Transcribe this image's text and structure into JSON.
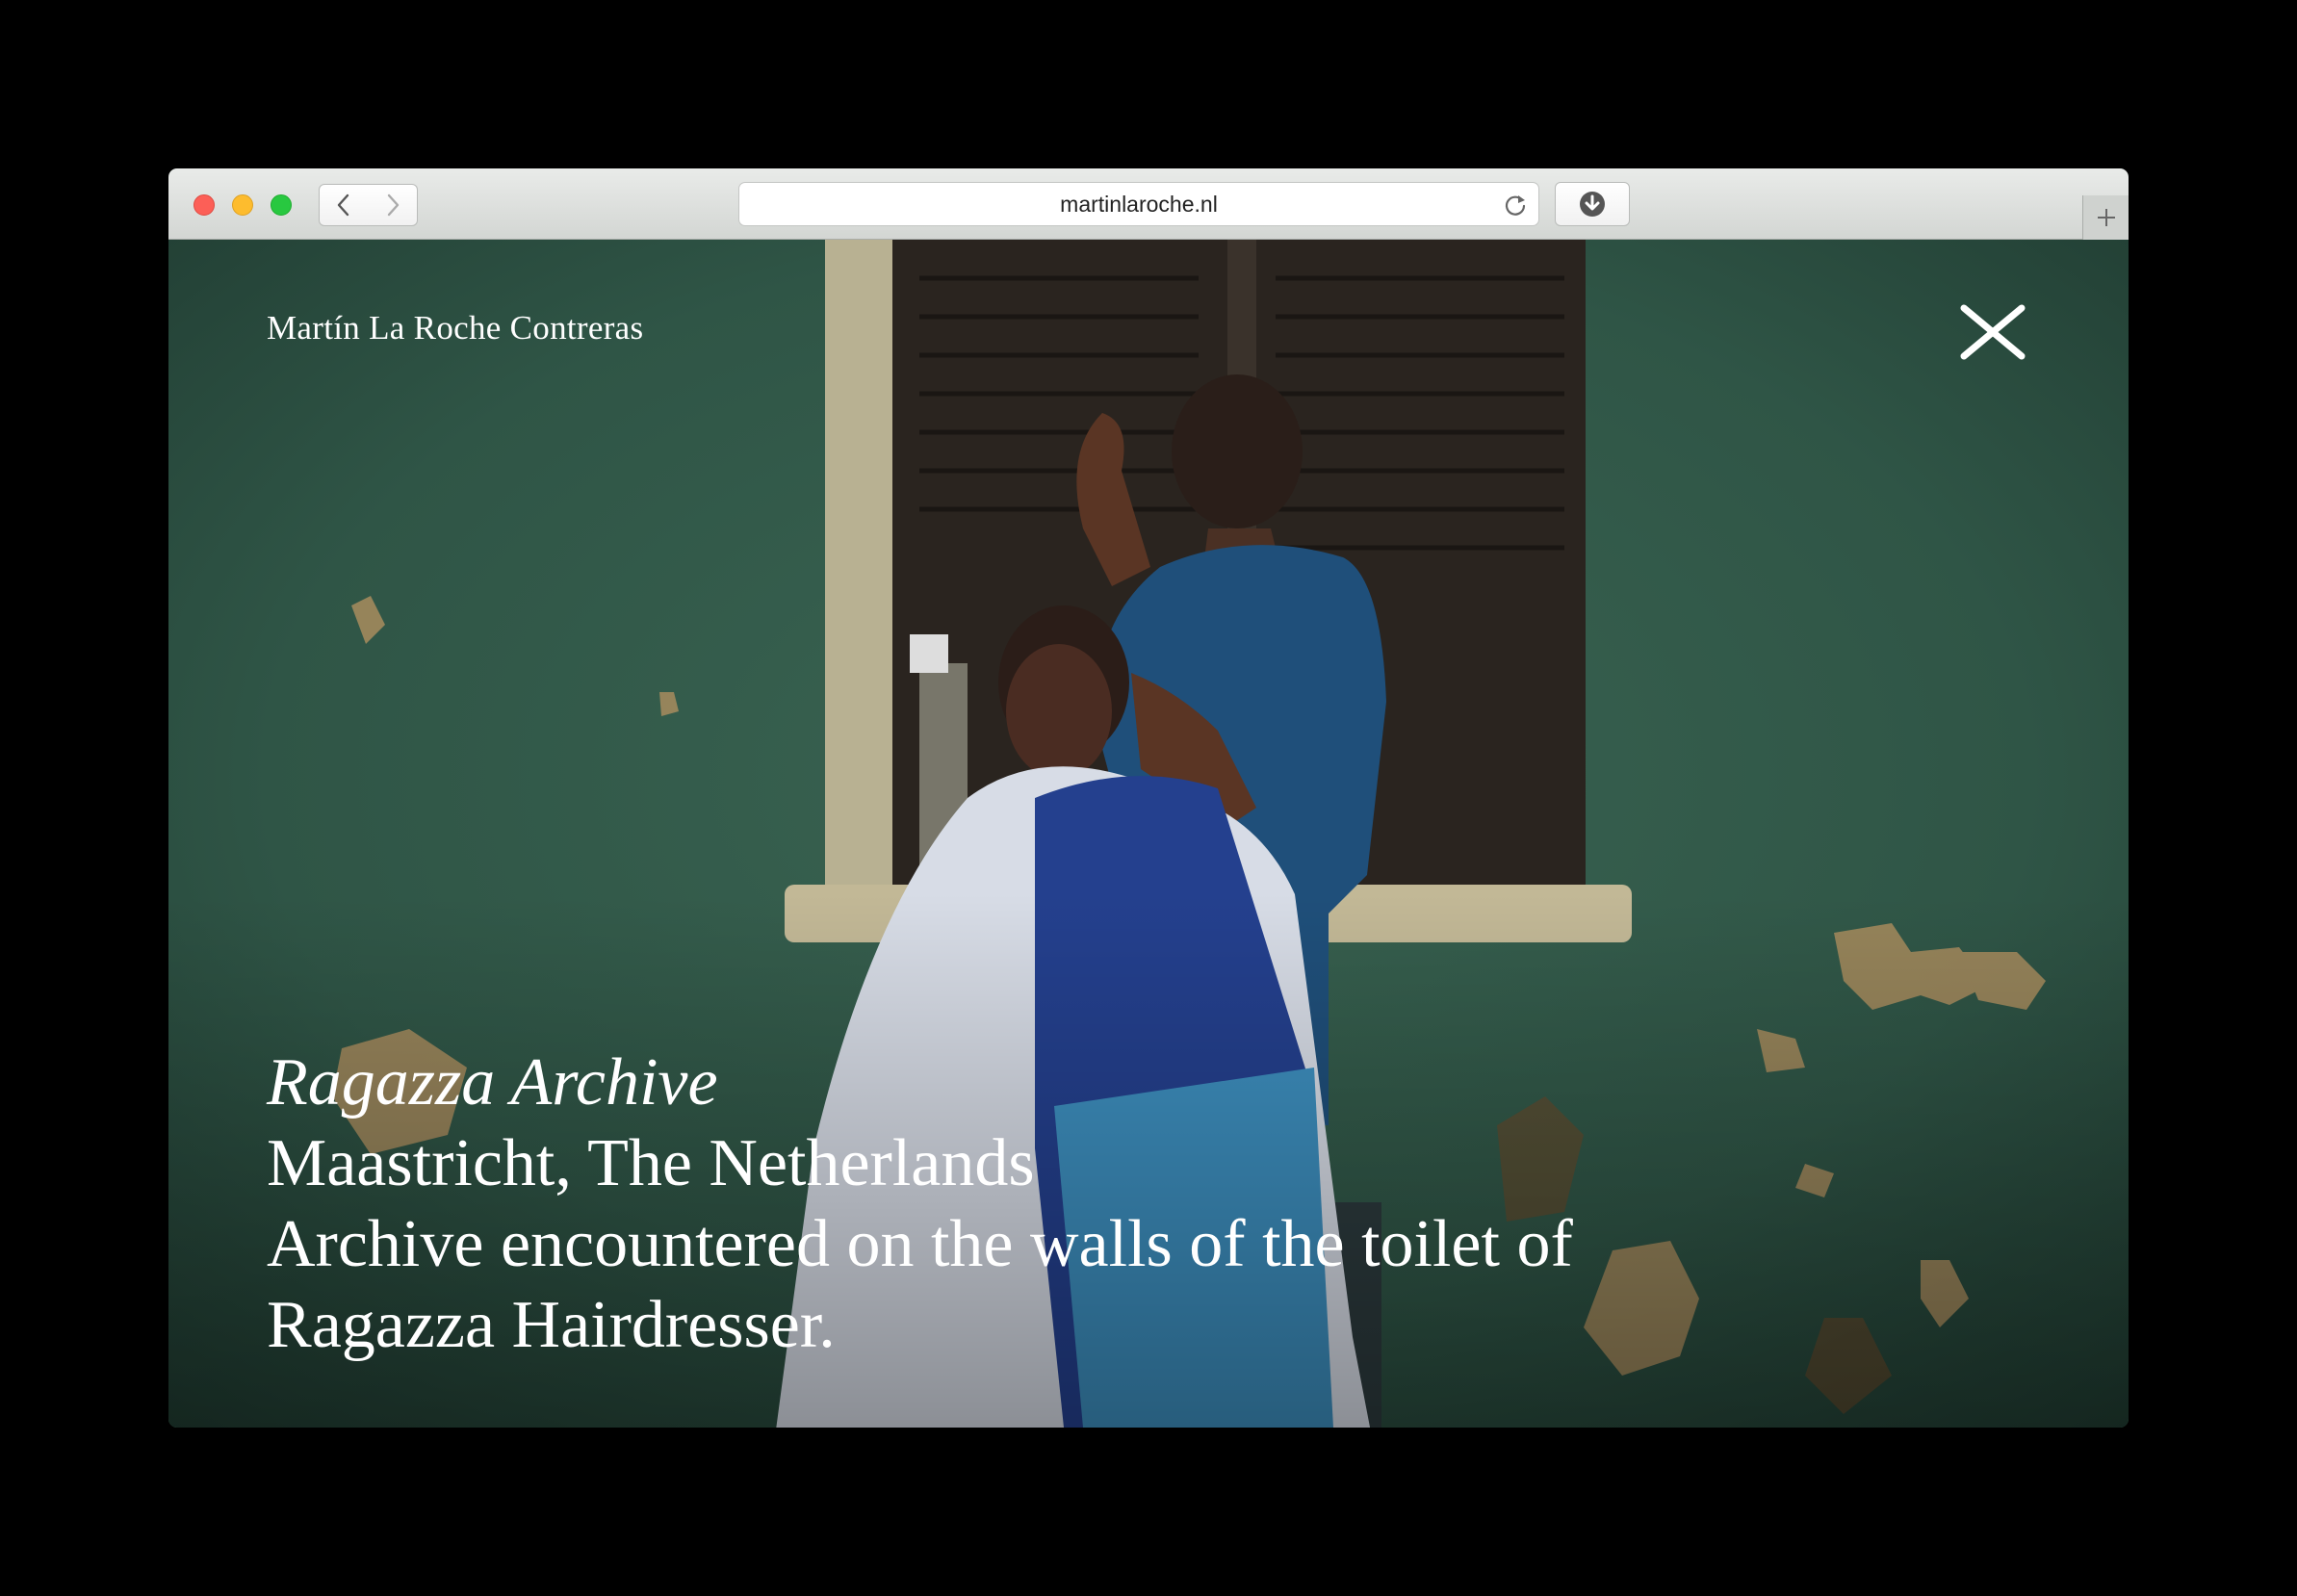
{
  "browser": {
    "url": "martinlaroche.nl",
    "buttons": {
      "back": "chevron-left-icon",
      "forward": "chevron-right-icon",
      "reload": "reload-icon",
      "download": "download-icon",
      "new_tab": "plus-icon"
    }
  },
  "site": {
    "name": "Martín La Roche Contreras",
    "close_icon": "close-icon"
  },
  "project": {
    "title": "Ragazza Archive",
    "location": "Maastricht, The Netherlands",
    "description_line1": "Archive encountered on the walls of the toilet of",
    "description_line2": "Ragazza Hairdresser."
  },
  "colors": {
    "wall_green": "#2f5243",
    "caption_text": "#ffffff",
    "cape_dark_blue": "#24408e",
    "cape_light_blue": "#3d8fbf",
    "cape_white": "#d7dce6"
  }
}
